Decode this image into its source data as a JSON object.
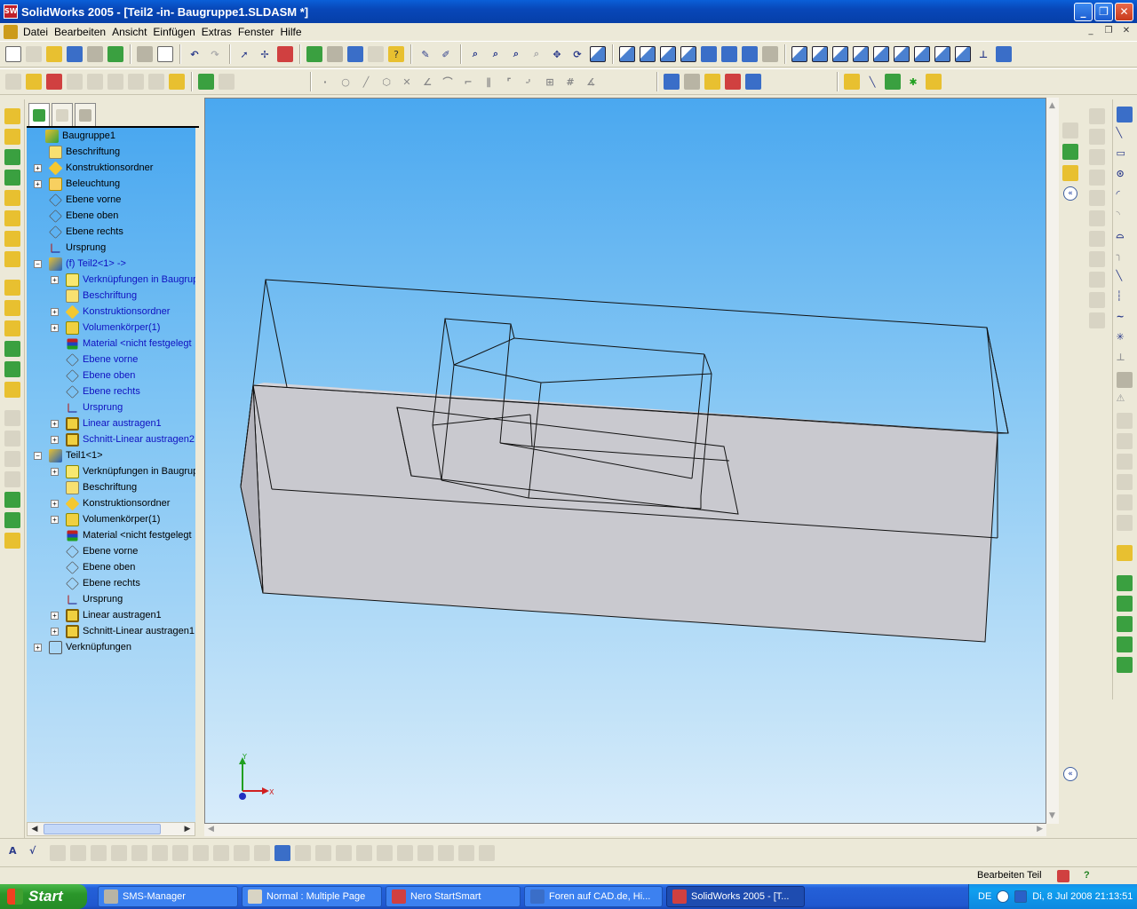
{
  "window": {
    "title": "SolidWorks 2005 - [Teil2 -in- Baugruppe1.SLDASM *]",
    "controls": [
      "minimize",
      "maximize",
      "close"
    ]
  },
  "menu": {
    "items": [
      "Datei",
      "Bearbeiten",
      "Ansicht",
      "Einfügen",
      "Extras",
      "Fenster",
      "Hilfe"
    ]
  },
  "feature_manager": {
    "tabs": [
      "feature-manager-tab",
      "property-manager-tab",
      "configuration-manager-tab"
    ],
    "tree": [
      {
        "label": "Baugruppe1",
        "icon": "assembly-icon",
        "expander": "",
        "blue": false
      },
      {
        "label": "Beschriftung",
        "icon": "annotation-icon",
        "expander": "",
        "blue": false
      },
      {
        "label": "Konstruktionsordner",
        "icon": "folder-icon",
        "expander": "+",
        "blue": false
      },
      {
        "label": "Beleuchtung",
        "icon": "lighting-icon",
        "expander": "+",
        "blue": false
      },
      {
        "label": "Ebene vorne",
        "icon": "plane-icon",
        "expander": "",
        "blue": false
      },
      {
        "label": "Ebene oben",
        "icon": "plane-icon",
        "expander": "",
        "blue": false
      },
      {
        "label": "Ebene rechts",
        "icon": "plane-icon",
        "expander": "",
        "blue": false
      },
      {
        "label": "Ursprung",
        "icon": "origin-icon",
        "expander": "",
        "blue": false
      },
      {
        "label": "(f) Teil2<1> ->",
        "icon": "part-icon",
        "expander": "−",
        "blue": true
      },
      {
        "label": "Verknüpfungen in Baugrup",
        "icon": "mates-folder-icon",
        "expander": "+",
        "blue": true
      },
      {
        "label": "Beschriftung",
        "icon": "annotation-icon",
        "expander": "",
        "blue": true
      },
      {
        "label": "Konstruktionsordner",
        "icon": "folder-icon",
        "expander": "+",
        "blue": true
      },
      {
        "label": "Volumenkörper(1)",
        "icon": "solid-bodies-icon",
        "expander": "+",
        "blue": true
      },
      {
        "label": "Material <nicht festgelegt",
        "icon": "material-icon",
        "expander": "",
        "blue": true
      },
      {
        "label": "Ebene vorne",
        "icon": "plane-icon",
        "expander": "",
        "blue": true
      },
      {
        "label": "Ebene oben",
        "icon": "plane-icon",
        "expander": "",
        "blue": true
      },
      {
        "label": "Ebene rechts",
        "icon": "plane-icon",
        "expander": "",
        "blue": true
      },
      {
        "label": "Ursprung",
        "icon": "origin-icon",
        "expander": "",
        "blue": true
      },
      {
        "label": "Linear austragen1",
        "icon": "extrude-icon",
        "expander": "+",
        "blue": true
      },
      {
        "label": "Schnitt-Linear austragen2",
        "icon": "cut-extrude-icon",
        "expander": "+",
        "blue": true
      },
      {
        "label": "Teil1<1>",
        "icon": "part-icon",
        "expander": "−",
        "blue": false
      },
      {
        "label": "Verknüpfungen in Baugrup",
        "icon": "mates-folder-icon",
        "expander": "+",
        "blue": false
      },
      {
        "label": "Beschriftung",
        "icon": "annotation-icon",
        "expander": "",
        "blue": false
      },
      {
        "label": "Konstruktionsordner",
        "icon": "folder-icon",
        "expander": "+",
        "blue": false
      },
      {
        "label": "Volumenkörper(1)",
        "icon": "solid-bodies-icon",
        "expander": "+",
        "blue": false
      },
      {
        "label": "Material <nicht festgelegt",
        "icon": "material-icon",
        "expander": "",
        "blue": false
      },
      {
        "label": "Ebene vorne",
        "icon": "plane-icon",
        "expander": "",
        "blue": false
      },
      {
        "label": "Ebene oben",
        "icon": "plane-icon",
        "expander": "",
        "blue": false
      },
      {
        "label": "Ebene rechts",
        "icon": "plane-icon",
        "expander": "",
        "blue": false
      },
      {
        "label": "Ursprung",
        "icon": "origin-icon",
        "expander": "",
        "blue": false
      },
      {
        "label": "Linear austragen1",
        "icon": "extrude-icon",
        "expander": "+",
        "blue": false
      },
      {
        "label": "Schnitt-Linear austragen1",
        "icon": "cut-extrude-icon",
        "expander": "+",
        "blue": false
      },
      {
        "label": "Verknüpfungen",
        "icon": "mates-icon",
        "expander": "+",
        "blue": false
      }
    ]
  },
  "viewport": {
    "triad": {
      "x_label": "X",
      "y_label": "Y"
    }
  },
  "statusbar": {
    "mode": "Bearbeiten Teil",
    "help": "?"
  },
  "taskbar": {
    "start": "Start",
    "buttons": [
      {
        "label": "SMS-Manager",
        "icon": "sms-icon",
        "active": false
      },
      {
        "label": "Normal : Multiple Page",
        "icon": "printer-icon",
        "active": false
      },
      {
        "label": "Nero StartSmart",
        "icon": "nero-icon",
        "active": false
      },
      {
        "label": "Foren auf CAD.de, Hi...",
        "icon": "ie-icon",
        "active": false
      },
      {
        "label": "SolidWorks 2005 - [T...",
        "icon": "solidworks-icon",
        "active": true
      }
    ],
    "tray": {
      "language": "DE",
      "clock": "Di, 8 Jul 2008  21:13:51"
    }
  },
  "colors": {
    "titlebar": "#0a5fd8",
    "viewport_top": "#4aa8f0",
    "viewport_bottom": "#d8ecfa",
    "taskbar": "#2460d8",
    "start_green": "#2a962a"
  }
}
